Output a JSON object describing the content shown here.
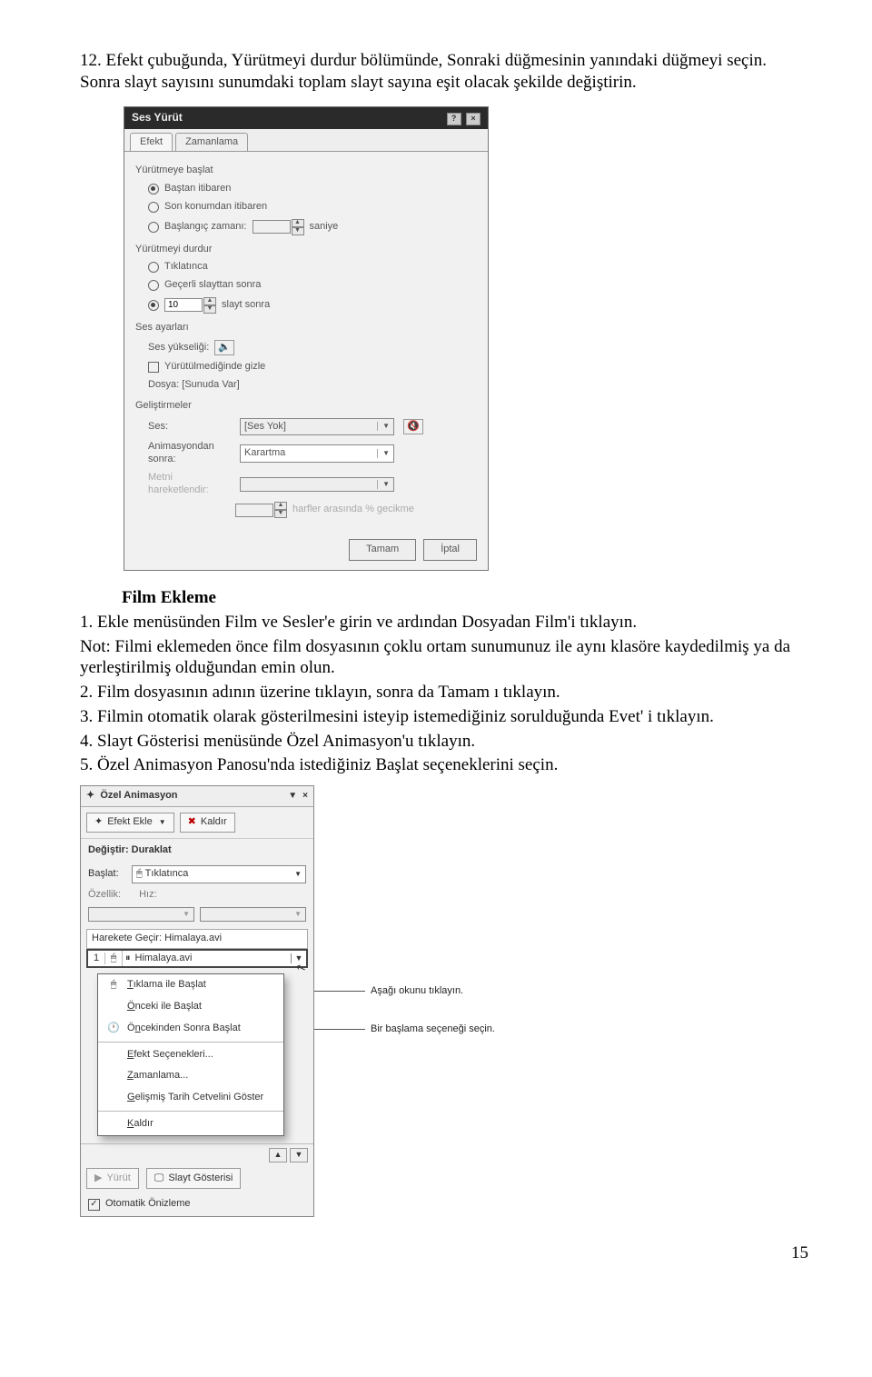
{
  "doc": {
    "p12": "12. Efekt çubuğunda, Yürütmeyi durdur bölümünde, Sonraki düğmesinin yanındaki düğmeyi seçin. Sonra slayt sayısını sunumdaki toplam slayt sayına eşit olacak şekilde değiştirin.",
    "film_heading": "Film Ekleme",
    "li1": "1.        Ekle menüsünden Film ve Sesler'e girin ve ardından Dosyadan Film'i tıklayın.",
    "note": "Not: Filmi eklemeden önce film dosyasının çoklu ortam sunumunuz ile aynı klasöre kaydedilmiş ya da yerleştirilmiş olduğundan emin olun.",
    "li2": "2.        Film dosyasının adının üzerine tıklayın, sonra da Tamam ı tıklayın.",
    "li3": "3.        Filmin otomatik olarak gösterilmesini isteyip istemediğiniz sorulduğunda Evet' i tıklayın.",
    "li4": "4.        Slayt Gösterisi menüsünde Özel Animasyon'u tıklayın.",
    "li5": "5.        Özel Animasyon Panosu'nda istediğiniz Başlat seçeneklerini seçin.",
    "page_no": "15"
  },
  "sesyurut": {
    "title": "Ses Yürüt",
    "tab1": "Efekt",
    "tab2": "Zamanlama",
    "grp_start": "Yürütmeye başlat",
    "r_bastan": "Baştan itibaren",
    "r_sonkonum": "Son konumdan itibaren",
    "r_baslangic": "Başlangıç zamanı:",
    "saniye": "saniye",
    "grp_stop": "Yürütmeyi durdur",
    "r_tiklatinca": "Tıklatınca",
    "r_gecerli": "Geçerli slayttan sonra",
    "r_slayt_sonra": "slayt sonra",
    "stop_after_value": "10",
    "grp_ses": "Ses ayarları",
    "ses_yuksekligi": "Ses yükseliği:",
    "yurutulmediginde": "Yürütülmediğinde gizle",
    "dosya": "Dosya: [Sunuda Var]",
    "grp_gel": "Geliştirmeler",
    "ses_label": "Ses:",
    "ses_value": "[Ses Yok]",
    "anim_label": "Animasyondan sonra:",
    "anim_value": "Karartma",
    "metin_label": "Metni hareketlendir:",
    "harfler": "harfler arasında % gecikme",
    "btn_ok": "Tamam",
    "btn_cancel": "İptal"
  },
  "ozel": {
    "title": "Özel Animasyon",
    "btn_efekt": "Efekt Ekle",
    "btn_kaldir": "Kaldır",
    "degistir": "Değiştir: Duraklat",
    "baslat_label": "Başlat:",
    "baslat_value": "Tıklatınca",
    "ozellik": "Özellik:",
    "hiz": "Hız:",
    "harekete": "Harekete Geçir: Himalaya.avi",
    "item_num": "1",
    "item_text": "Himalaya.avi",
    "ctx_tiklama": "Tıklama ile Başlat",
    "ctx_onceki": "Önceki ile Başlat",
    "ctx_oncekinden": "Öncekinden Sonra Başlat",
    "ctx_efekt": "Efekt Seçenekleri...",
    "ctx_zaman": "Zamanlama...",
    "ctx_gelismis": "Gelişmiş Tarih Cetvelini Göster",
    "ctx_kaldir": "Kaldır",
    "btn_yurut": "Yürüt",
    "btn_slayt": "Slayt Gösterisi",
    "autoprev": "Otomatik Önizleme",
    "callout1": "Aşağı okunu tıklayın.",
    "callout2": "Bir başlama seçeneği seçin."
  }
}
